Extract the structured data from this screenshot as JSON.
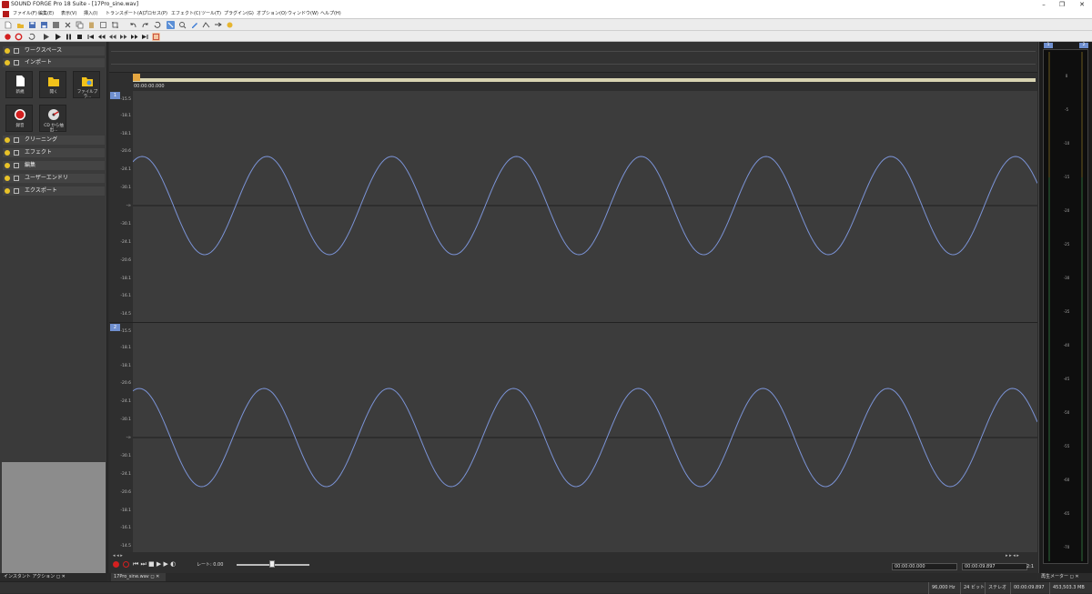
{
  "window": {
    "title": "SOUND FORGE Pro 18 Suite - [17Pro_sine.wav]"
  },
  "menu": [
    "ファイル(F)",
    "編集(E)",
    "表示(V)",
    "挿入(I)",
    "トランスポート(A)",
    "プロセス(P)",
    "エフェクト(C)",
    "ツール(T)",
    "プラグイン(G)",
    "オプション(O)",
    "ウィンドウ(W)",
    "ヘルプ(H)"
  ],
  "left_panel": {
    "sections_top": [
      "ワークスペース",
      "インポート"
    ],
    "tiles": [
      "新規",
      "開く",
      "ファイルブラ...",
      "録音",
      "CD から抽出..."
    ],
    "sections_bottom": [
      "クリーニング",
      "エフェクト",
      "編集",
      "ユーザーエンドリ",
      "エクスポート"
    ],
    "tab_label": "インスタント アクション"
  },
  "editor": {
    "ruler_time": "00:00:00.000",
    "channels": [
      "1",
      "2"
    ],
    "ticks": [
      "-15.5",
      "-18.1",
      "-18.1",
      "-20.6",
      "-24.1",
      "-30.1",
      "-∞",
      "-30.1",
      "-24.1",
      "-20.6",
      "-18.1",
      "-16.1",
      "-14.5"
    ],
    "rate_label": "レート: 0.00",
    "time_left": "00:00:00.000",
    "time_right": "00:00:09.897",
    "zoom_ratio": "2:1",
    "tab_label": "17Pro_sine.wav"
  },
  "meter": {
    "tab_label": "再生メーター",
    "channels": [
      "1",
      "2"
    ],
    "scale": [
      "0",
      "-5",
      "-10",
      "-15",
      "-20",
      "-25",
      "-30",
      "-35",
      "-40",
      "-45",
      "-50",
      "-55",
      "-60",
      "-65",
      "-70"
    ]
  },
  "status": [
    "96,000 Hz",
    "24 ビット",
    "ステレオ",
    "00:00:09.897",
    "453,503.3 MB"
  ],
  "colors": {
    "waveform": "#7b93d6",
    "accent": "#e8c228",
    "record": "#d32020",
    "channel_badge": "#6f8fcf"
  }
}
